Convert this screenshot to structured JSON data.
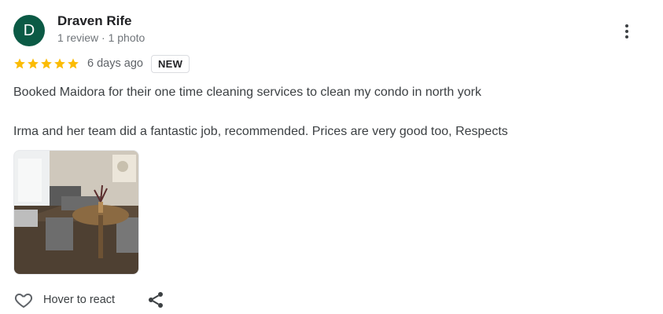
{
  "reviewer": {
    "initial": "D",
    "name": "Draven Rife",
    "meta": "1 review · 1 photo",
    "avatar_color": "#0b5a45"
  },
  "rating": {
    "stars": 5,
    "max": 5,
    "star_color": "#fbbc04"
  },
  "review": {
    "date": "6 days ago",
    "badge": "NEW",
    "paragraphs": [
      "Booked Maidora for their one time cleaning services to clean my condo in north york",
      "Irma and her team did a fantastic job, recommended. Prices are very good too, Respects"
    ],
    "photo_icon": "condo-dining-room-photo"
  },
  "actions": {
    "react_label": "Hover to react",
    "react_icon": "heart-outline-icon",
    "share_icon": "share-icon",
    "more_icon": "more-vertical-icon"
  }
}
